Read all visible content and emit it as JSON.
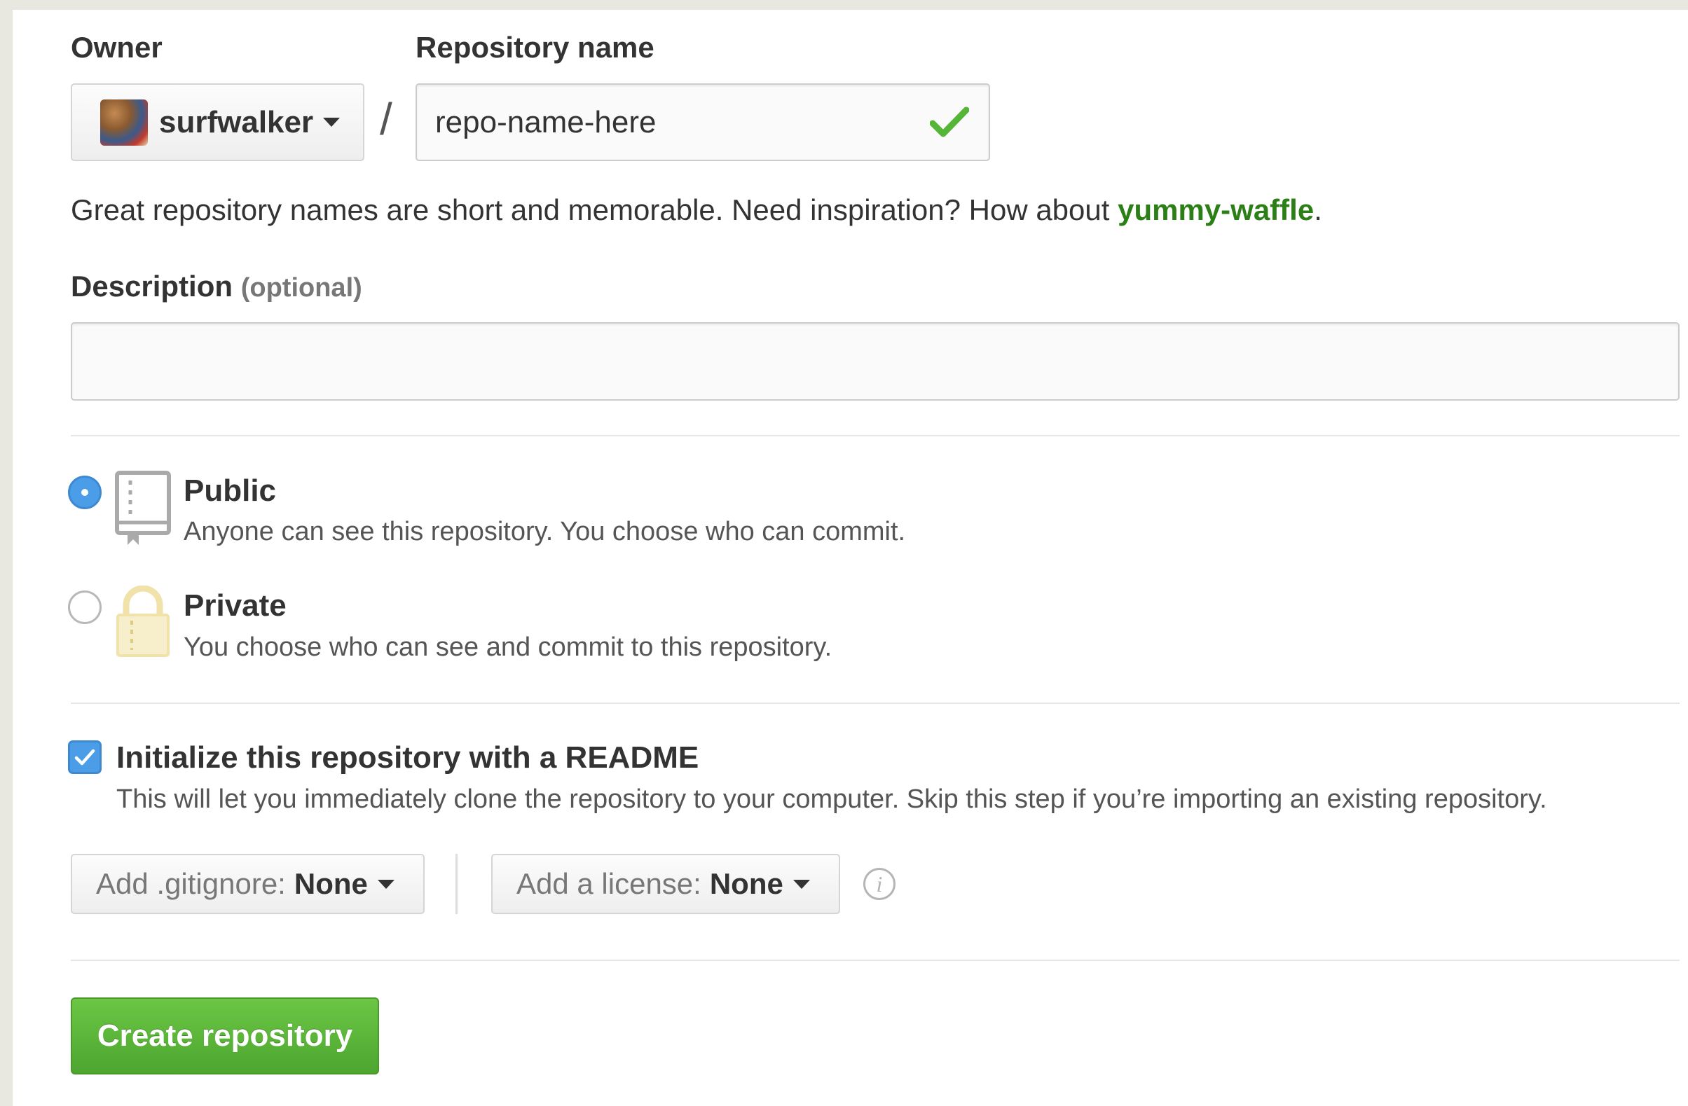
{
  "owner": {
    "label": "Owner",
    "name": "surfwalker"
  },
  "repository": {
    "label": "Repository name",
    "value": "repo-name-here",
    "separator": "/"
  },
  "hint": {
    "text": "Great repository names are short and memorable. Need inspiration? How about ",
    "suggestion": "yummy-waffle",
    "end": "."
  },
  "description": {
    "label": "Description",
    "optional": "(optional)",
    "value": ""
  },
  "visibility": {
    "public": {
      "title": "Public",
      "description": "Anyone can see this repository. You choose who can commit.",
      "selected": true
    },
    "private": {
      "title": "Private",
      "description": "You choose who can see and commit to this repository.",
      "selected": false
    }
  },
  "readme": {
    "title": "Initialize this repository with a README",
    "description": "This will let you immediately clone the repository to your computer. Skip this step if you’re importing an existing repository.",
    "checked": true
  },
  "gitignore": {
    "label": "Add .gitignore:",
    "value": "None"
  },
  "license": {
    "label": "Add a license:",
    "value": "None"
  },
  "info_icon": "i",
  "create_button": "Create repository",
  "colors": {
    "primary_button": "#55b536",
    "suggestion_link": "#2c7f16",
    "radio_selected": "#4a9de6",
    "lock_icon": "#f0e2a8"
  }
}
